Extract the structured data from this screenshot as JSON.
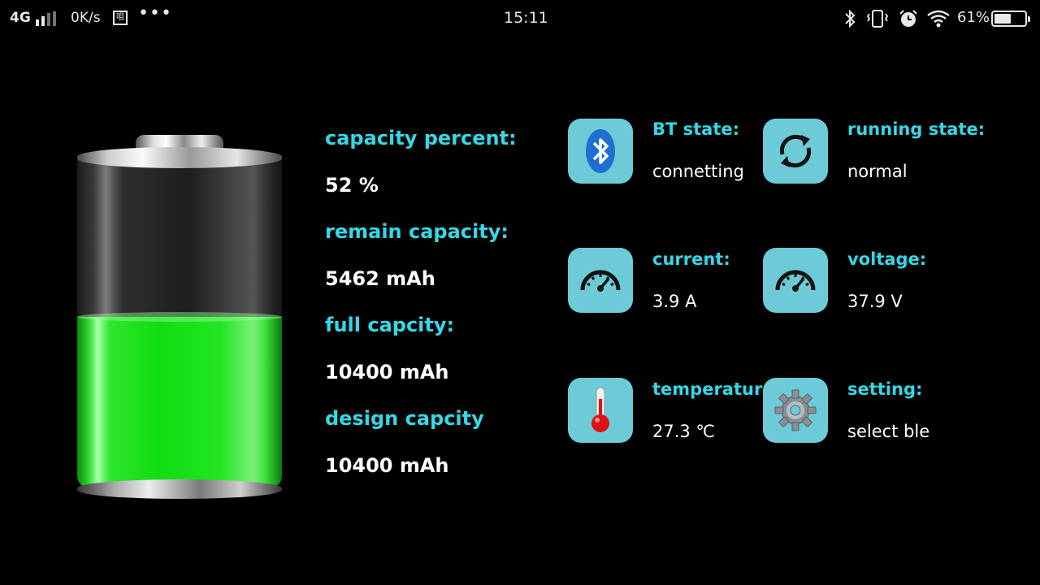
{
  "status_bar": {
    "network": "4G",
    "speed": "0K/s",
    "notification_glyph": "咀",
    "more": "•••",
    "time": "15:11",
    "battery_percent_text": "61%",
    "battery_level": 0.61,
    "icons": [
      "signal-icon",
      "bluetooth-icon",
      "vibrate-icon",
      "alarm-icon",
      "wifi-icon",
      "battery-icon"
    ]
  },
  "battery": {
    "fill_level": 0.52,
    "fill_color": "#22e622"
  },
  "info": {
    "capacity_percent_label": "capacity percent:",
    "capacity_percent_value": "52 %",
    "remain_capacity_label": "remain capacity:",
    "remain_capacity_value": "5462 mAh",
    "full_capacity_label": "full capcity:",
    "full_capacity_value": "10400 mAh",
    "design_capacity_label": "design capcity",
    "design_capacity_value": "10400 mAh"
  },
  "tiles": {
    "bt_state": {
      "label": "BT state:",
      "value": "connetting",
      "icon": "bluetooth-icon"
    },
    "running_state": {
      "label": "running state:",
      "value": "normal",
      "icon": "refresh-icon"
    },
    "current": {
      "label": "current:",
      "value": "3.9 A",
      "icon": "gauge-icon"
    },
    "voltage": {
      "label": "voltage:",
      "value": "37.9 V",
      "icon": "gauge-icon"
    },
    "temperature": {
      "label": "temperature:",
      "value": "27.3 ℃",
      "icon": "thermometer-icon"
    },
    "setting": {
      "label": "setting:",
      "value": "select ble",
      "icon": "gear-icon"
    }
  },
  "colors": {
    "accent": "#34d8e6",
    "tile_bg": "#6ccbd6",
    "background": "#000000"
  }
}
